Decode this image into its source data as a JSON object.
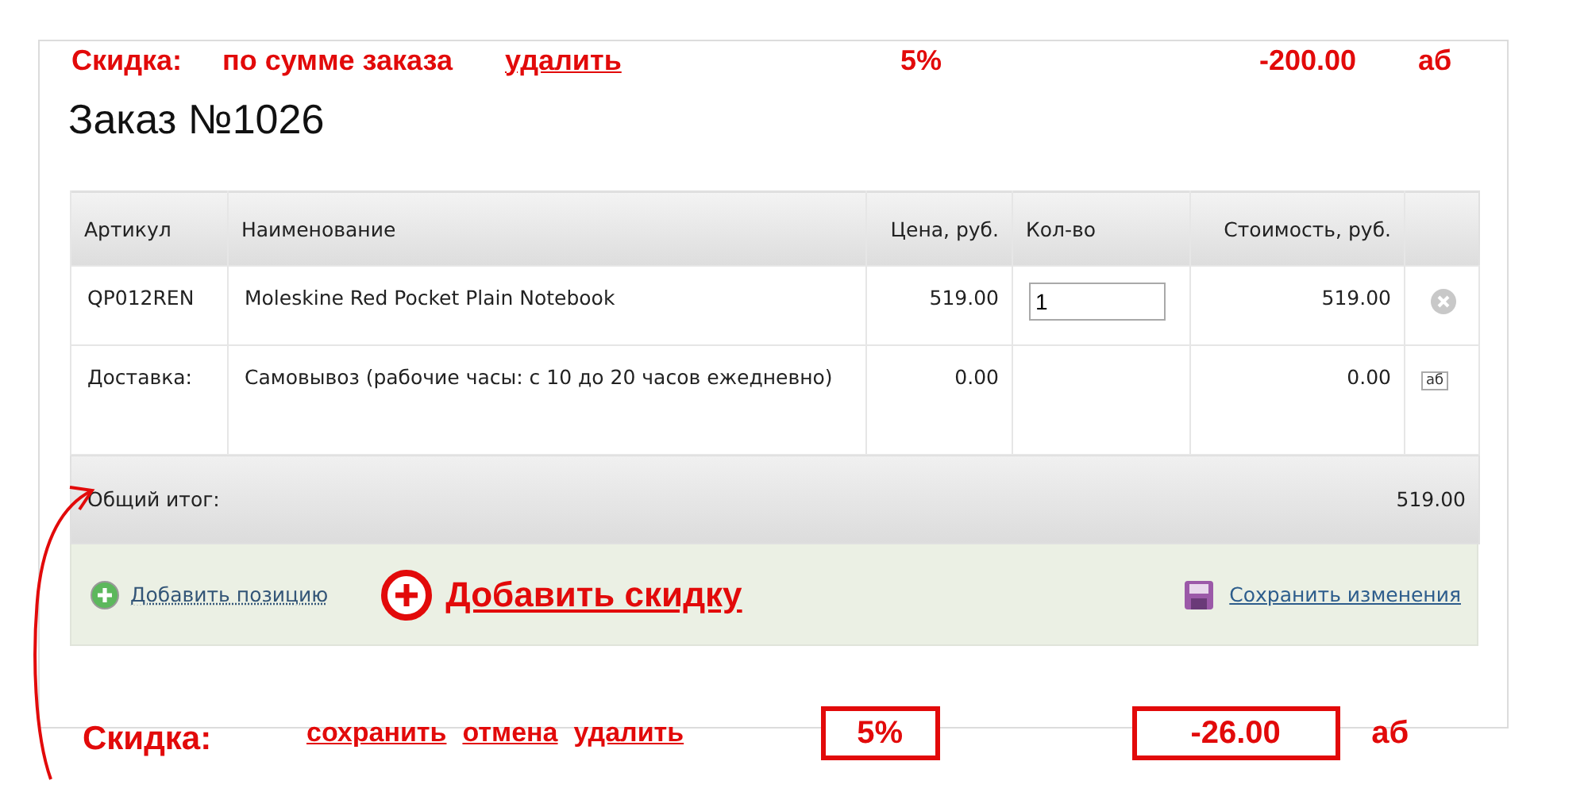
{
  "discount_summary": {
    "label": "Скидка:",
    "type": "по сумме заказа",
    "delete_link": "удалить",
    "percent": "5%",
    "amount": "-200.00",
    "currency": "аб"
  },
  "order_title": "Заказ №1026",
  "table": {
    "columns": [
      "Артикул",
      "Наименование",
      "Цена, руб.",
      "Кол-во",
      "Стоимость, руб."
    ],
    "rows": [
      {
        "kind": "item",
        "article": "QP012REN",
        "name": "Moleskine Red Pocket Plain Notebook",
        "price": "519.00",
        "quantity": "1",
        "cost": "519.00"
      },
      {
        "kind": "delivery",
        "article": "Доставка:",
        "name": "Самовывоз (рабочие часы: с 10 до 20 часов ежедневно)",
        "price": "0.00",
        "cost": "0.00",
        "action": "аб"
      }
    ],
    "total_label": "Общий итог:",
    "total": "519.00"
  },
  "footer": {
    "add_item": "Добавить позицию",
    "add_discount": "Добавить скидку",
    "save": "Сохранить изменения"
  },
  "discount_editor": {
    "label": "Скидка:",
    "links": [
      "сохранить",
      "отмена",
      "удалить"
    ],
    "percent": "5%",
    "amount": "-26.00",
    "currency": "аб"
  }
}
